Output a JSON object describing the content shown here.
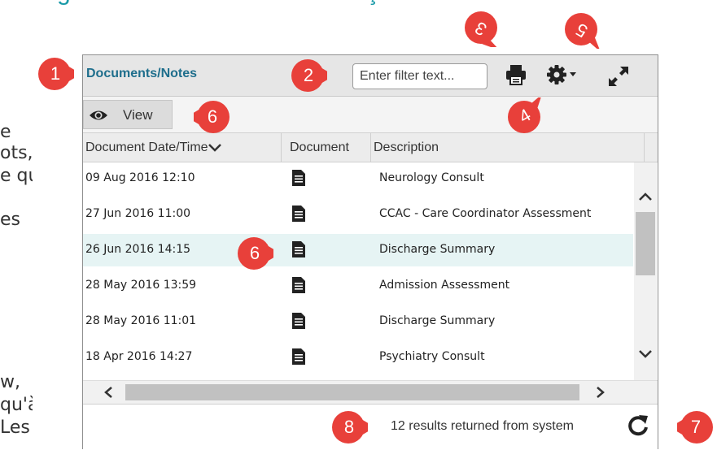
{
  "background": {
    "title_fragment": "g",
    "title_fragment_2": "ç",
    "side_fragments": [
      "e",
      "ots,",
      "e qui",
      "es",
      "w,",
      "qu'à",
      "Les"
    ]
  },
  "panel": {
    "title": "Documents/Notes",
    "filter_placeholder": "Enter filter text...",
    "view_label": "View",
    "columns": [
      "Document Date/Time",
      "Document",
      "Description"
    ],
    "rows": [
      {
        "date": "09 Aug 2016 12:10",
        "description": "Neurology Consult",
        "selected": false
      },
      {
        "date": "27 Jun 2016 11:00",
        "description": "CCAC - Care Coordinator Assessment",
        "selected": false
      },
      {
        "date": "26 Jun 2016 14:15",
        "description": "Discharge Summary",
        "selected": true
      },
      {
        "date": "28 May 2016 13:59",
        "description": "Admission Assessment",
        "selected": false
      },
      {
        "date": "28 May 2016 11:01",
        "description": "Discharge Summary",
        "selected": false
      },
      {
        "date": "18 Apr 2016 14:27",
        "description": "Psychiatry Consult",
        "selected": false
      }
    ],
    "results_text": "12 results returned from system"
  },
  "callouts": [
    "1",
    "2",
    "3",
    "4",
    "5",
    "6",
    "6",
    "7",
    "8"
  ],
  "colors": {
    "callout_red": "#e8403a",
    "title_teal": "#1e6e8c",
    "selected_row": "#e6f4f4"
  },
  "icons": [
    "printer-icon",
    "gear-icon",
    "expand-icon",
    "eye-icon",
    "document-icon",
    "refresh-icon",
    "chevron-down-icon"
  ]
}
